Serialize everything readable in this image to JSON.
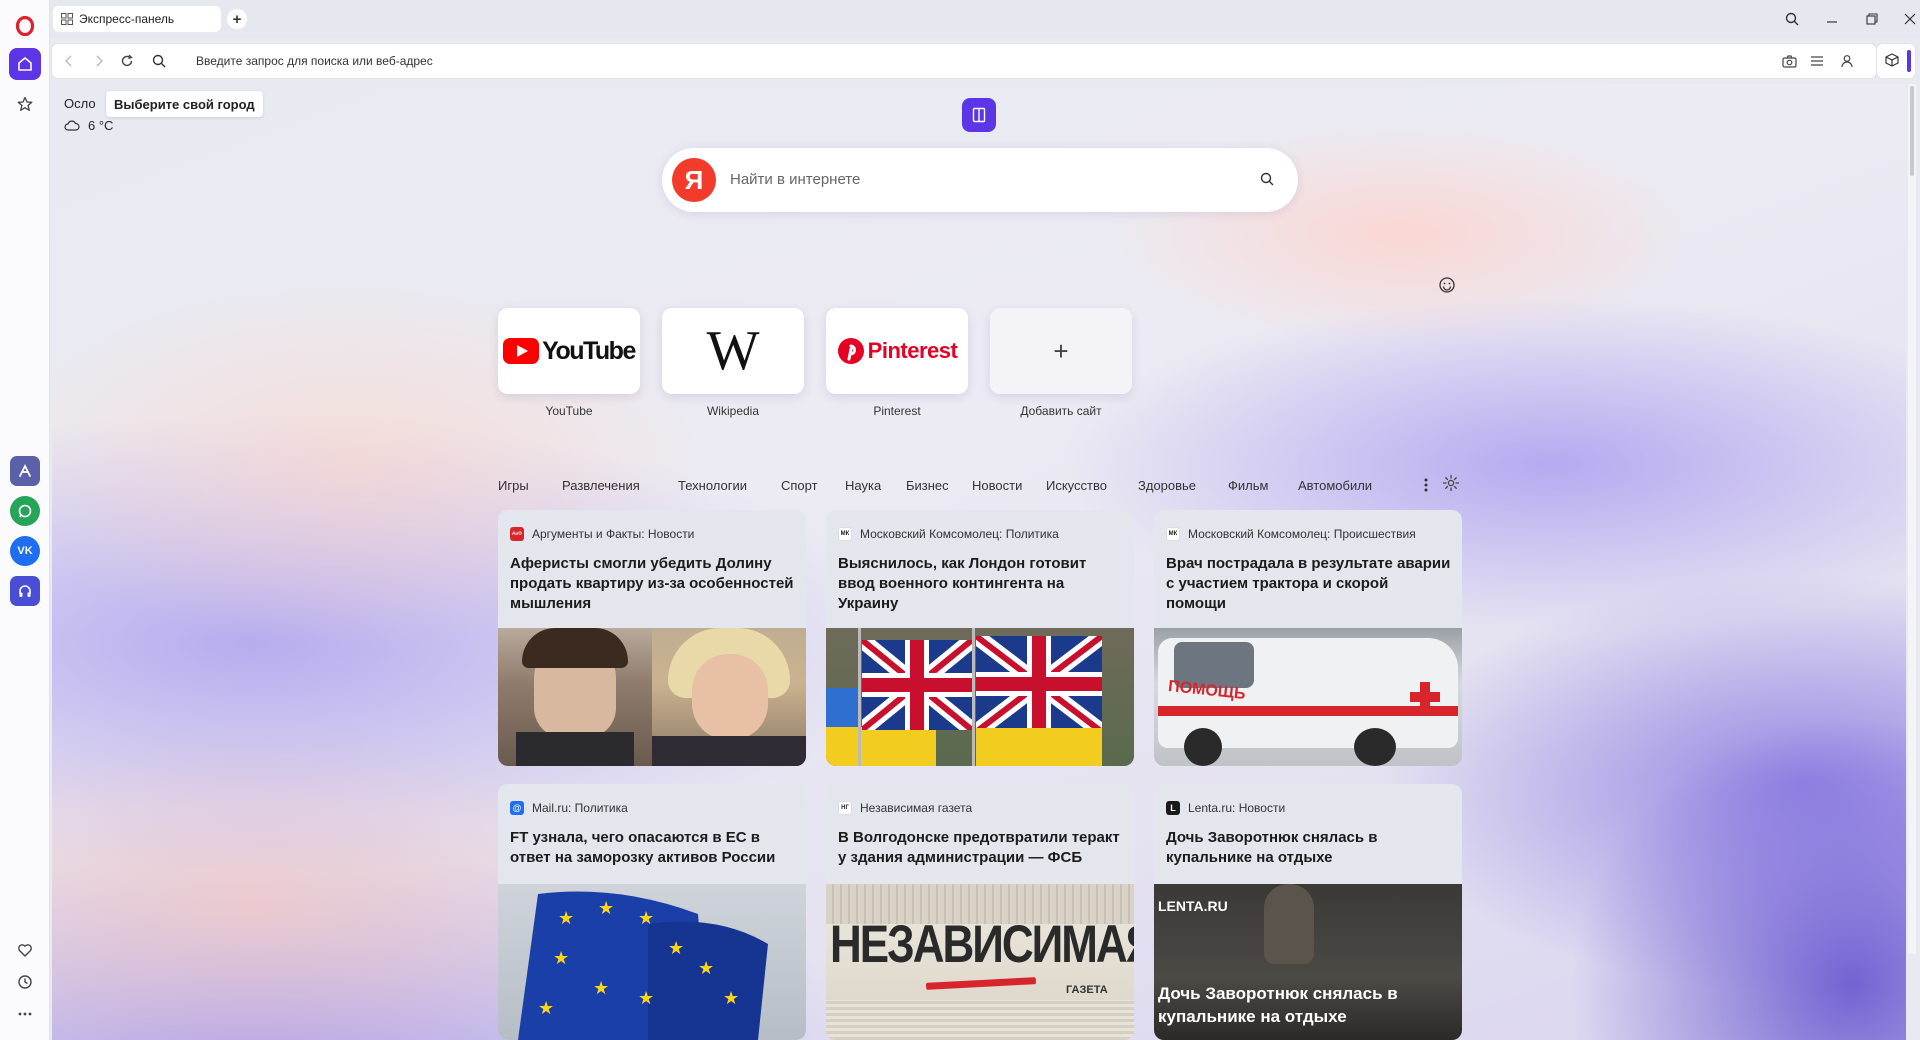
{
  "tab": {
    "title": "Экспресс-панель"
  },
  "address_bar": {
    "placeholder": "Введите запрос для поиска или веб-адрес"
  },
  "weather": {
    "city": "Осло",
    "tooltip": "Выберите свой город",
    "temperature": "6 °C"
  },
  "search": {
    "placeholder": "Найти в интернете",
    "engine_letter": "Я"
  },
  "speed_dial": [
    {
      "label": "YouTube",
      "logo_text": "YouTube"
    },
    {
      "label": "Wikipedia",
      "logo_text": "W"
    },
    {
      "label": "Pinterest",
      "logo_text": "Pinterest"
    },
    {
      "label": "Добавить сайт",
      "logo_text": "+"
    }
  ],
  "categories": [
    "Игры",
    "Развлечения",
    "Технологии",
    "Спорт",
    "Наука",
    "Бизнес",
    "Новости",
    "Искусство",
    "Здоровье",
    "Фильм",
    "Автомобили"
  ],
  "news": [
    {
      "source": "Аргументы и Факты: Новости",
      "title": "Аферисты смогли убедить Долину продать квартиру из-за особенностей мышления",
      "icon_color": "#d7262b",
      "icon_text": "АиФ"
    },
    {
      "source": "Московский Комсомолец: Политика",
      "title": "Выяснилось, как Лондон готовит ввод военного контингента на Украину",
      "icon_color": "#ffffff",
      "icon_text": "МК"
    },
    {
      "source": "Московский Комсомолец: Происшествия",
      "title": "Врач пострадала в результате аварии с участием трактора и скорой помощи",
      "icon_color": "#ffffff",
      "icon_text": "МК"
    },
    {
      "source": "Mail.ru: Политика",
      "title": "FT узнала, чего опасаются в ЕС в ответ на заморозку активов России",
      "icon_color": "#1e6ef0",
      "icon_text": "@"
    },
    {
      "source": "Независимая газета",
      "title": "В Волгодонске предотвратили теракт у здания администрации — ФСБ",
      "icon_color": "#ffffff",
      "icon_text": "НГ"
    },
    {
      "source": "Lenta.ru: Новости",
      "title": "Дочь Заворотнюк снялась в купальнике на отдыхе",
      "icon_color": "#1a1a1a",
      "icon_text": "L"
    }
  ],
  "news_images": {
    "ambulance_text": "ПОМОЩЬ",
    "ng_masthead": "НЕЗАВИСИМАЯ",
    "ng_small": "ГАЗЕТА",
    "lenta_brand": "LENTA.RU",
    "lenta_overlay": "Дочь Заворотнюк снялась в купальнике на отдыхе"
  },
  "colors": {
    "accent": "#5b35e6",
    "opera_red": "#e0202e",
    "yandex_red": "#f33b2b"
  }
}
